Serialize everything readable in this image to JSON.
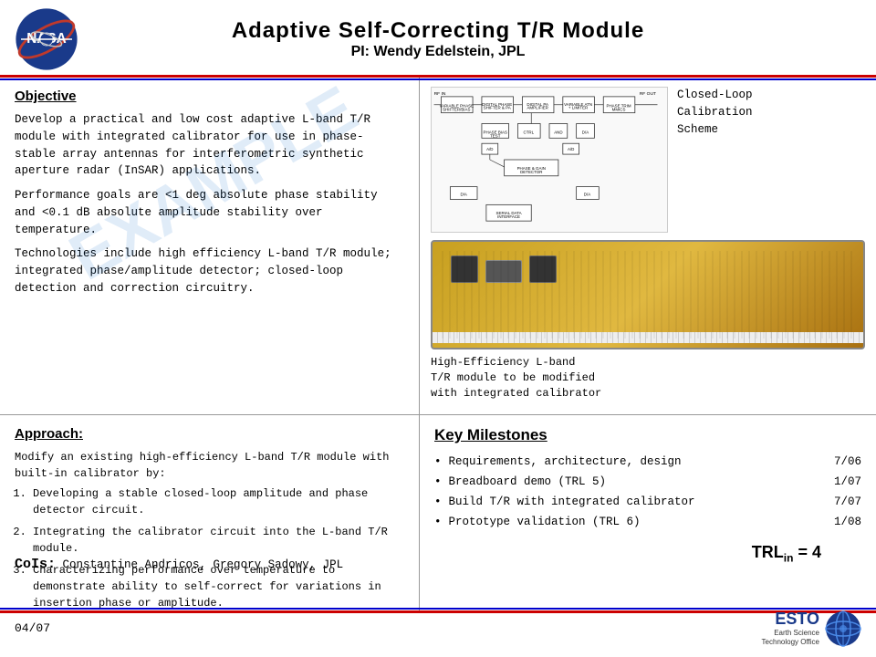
{
  "header": {
    "title": "Adaptive Self-Correcting T/R Module",
    "subtitle": "PI: Wendy Edelstein, JPL"
  },
  "objective": {
    "heading": "Objective",
    "paragraphs": [
      "Develop a practical and low cost  adaptive L-band T/R module with integrated calibrator for use in phase-stable array antennas for interferometric synthetic aperture radar (InSAR) applications.",
      "Performance goals are <1 deg absolute phase stability and <0.1 dB absolute amplitude stability over temperature.",
      "Technologies  include high efficiency L-band T/R module; integrated phase/amplitude detector; closed-loop detection and correction circuitry."
    ]
  },
  "calibration": {
    "label": "Closed-Loop\nCalibration\nScheme"
  },
  "device_caption": "High-Efficiency L-band\nT/R module to be modified\nwith integrated calibrator",
  "approach": {
    "heading": "Approach:",
    "intro": "Modify an existing high-efficiency L-band T/R module with built-in calibrator by:",
    "steps": [
      "Developing a stable closed-loop amplitude and phase detector circuit.",
      "Integrating the calibrator circuit into the L-band T/R module.",
      "Characterizing performance over temperature to demonstrate ability to self-correct for variations in insertion phase or amplitude."
    ]
  },
  "cois": {
    "label": "CoIs:",
    "names": "Constantine Andricos, Gregory Sadowy, JPL"
  },
  "milestones": {
    "heading": "Key Milestones",
    "items": [
      {
        "text": "Requirements, architecture, design",
        "date": "7/06"
      },
      {
        "text": "Breadboard demo (TRL 5)",
        "date": "1/07"
      },
      {
        "text": "Build T/R with integrated calibrator",
        "date": "7/07"
      },
      {
        "text": "Prototype validation (TRL 6)",
        "date": "1/08"
      }
    ]
  },
  "trl": {
    "label": "TRL",
    "subscript": "in",
    "value": "= 4"
  },
  "footer": {
    "date": "04/07"
  },
  "watermark": "EXAMPLE"
}
